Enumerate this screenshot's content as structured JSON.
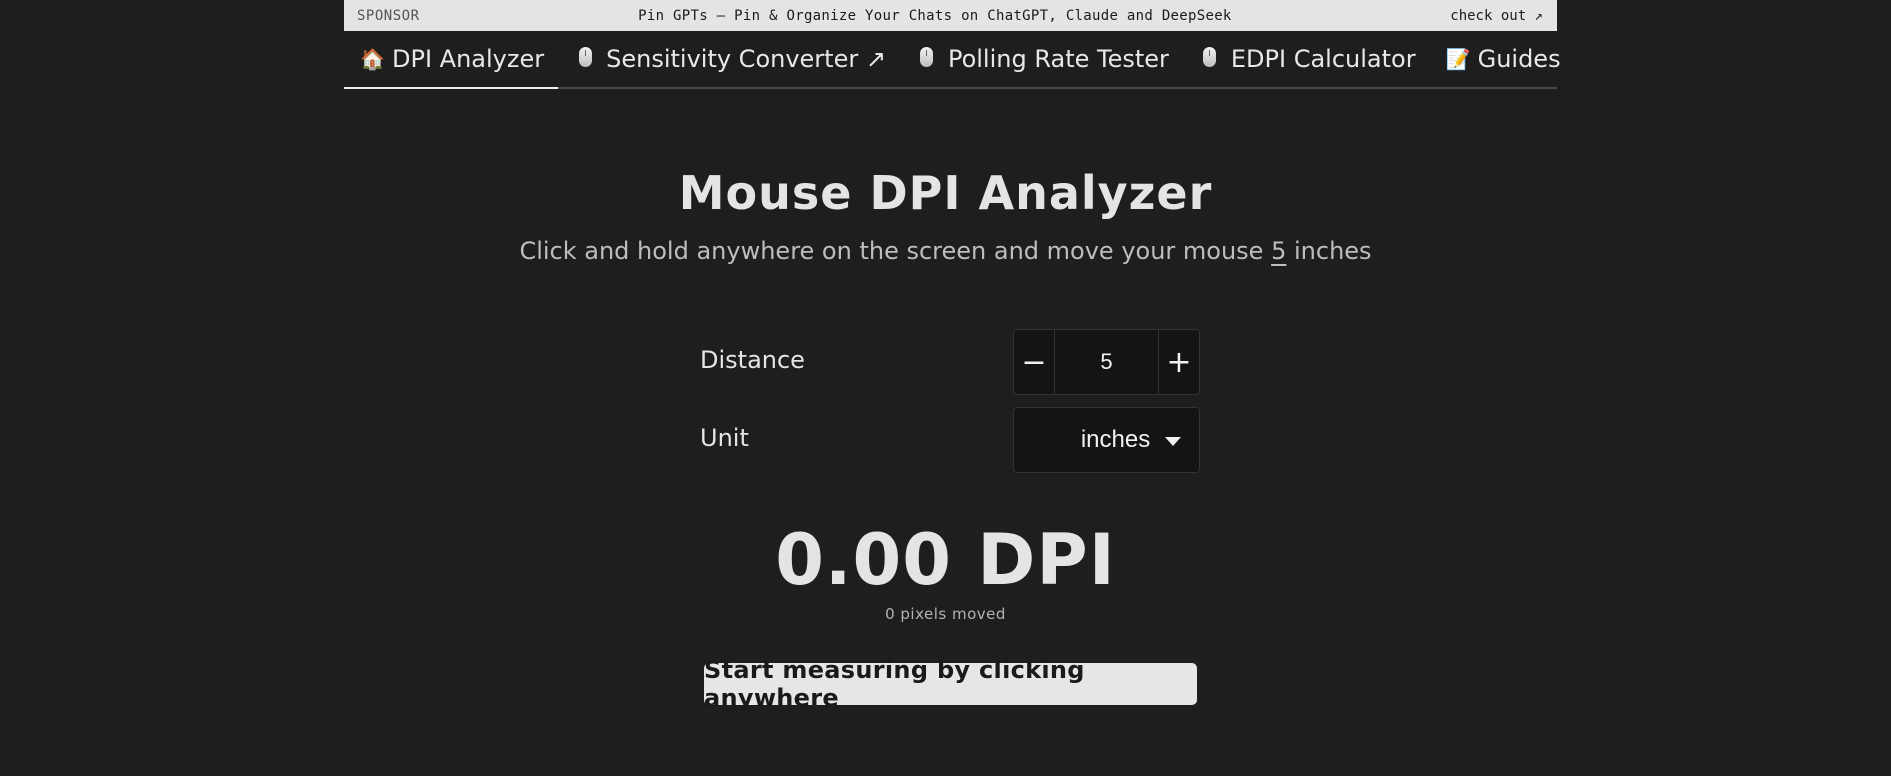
{
  "sponsor": {
    "label": "SPONSOR",
    "text": "Pin GPTs — Pin & Organize Your Chats on ChatGPT, Claude and DeepSeek",
    "link": "check out ↗"
  },
  "nav": {
    "items": [
      {
        "icon": "house-emoji-icon",
        "glyph": "🏠",
        "label": "DPI Analyzer",
        "active": true
      },
      {
        "icon": "mouse-icon",
        "label": "Sensitivity Converter ↗"
      },
      {
        "icon": "mouse-icon",
        "label": "Polling Rate Tester"
      },
      {
        "icon": "mouse-icon",
        "label": "EDPI Calculator"
      },
      {
        "icon": "memo-icon",
        "glyph": "📝",
        "label": "Guides"
      }
    ]
  },
  "main": {
    "title": "Mouse DPI Analyzer",
    "subtitle_before": "Click and hold anywhere on the screen and move your mouse ",
    "subtitle_value": "5",
    "subtitle_after": " inches",
    "distance_label": "Distance",
    "distance_value": "5",
    "minus_symbol": "−",
    "plus_symbol": "+",
    "unit_label": "Unit",
    "unit_value": "inches",
    "dpi_result": "0.00 DPI",
    "pixels_moved": "0 pixels moved",
    "start_button": "Start measuring by clicking anywhere"
  },
  "colors": {
    "background": "#1e1e1e",
    "sponsor_bar": "#e4e4e4",
    "button": "#e6e6e6"
  }
}
